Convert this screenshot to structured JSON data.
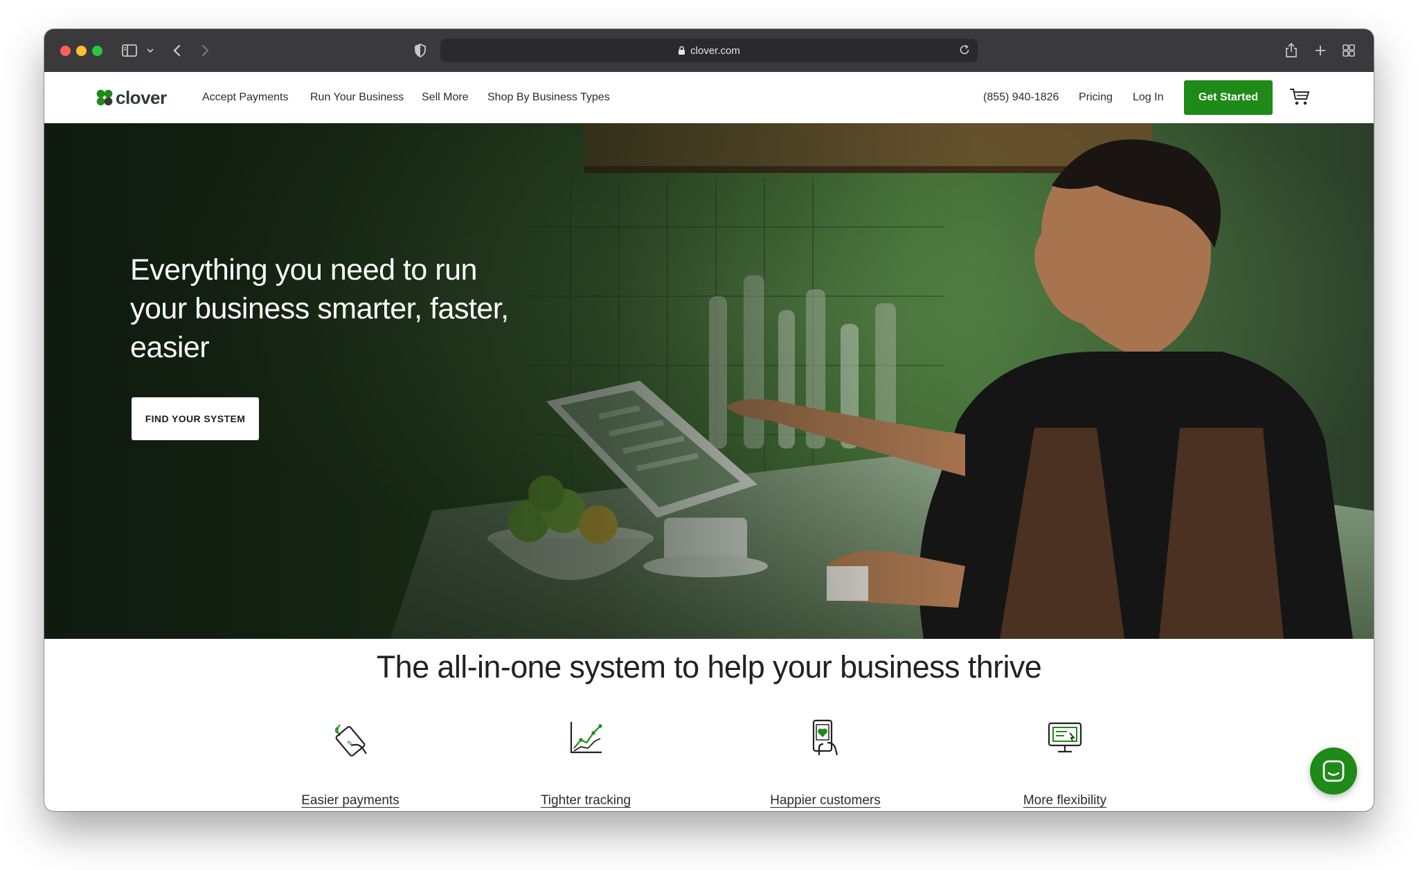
{
  "browser": {
    "url": "clover.com"
  },
  "nav": {
    "logo_text": "clover",
    "links": [
      "Accept Payments",
      "Run Your Business",
      "Sell More",
      "Shop By Business Types"
    ],
    "phone": "(855) 940-1826",
    "pricing": "Pricing",
    "login": "Log In",
    "cta": "Get Started",
    "cart_icon": "cart-icon"
  },
  "hero": {
    "headline": "Everything you need to run your business smarter, faster, easier",
    "button": "FIND YOUR SYSTEM"
  },
  "features": {
    "title": "The all-in-one system to help your business thrive",
    "items": [
      {
        "label": "Easier payments",
        "icon": "contactless-card-icon"
      },
      {
        "label": "Tighter tracking",
        "icon": "line-chart-icon"
      },
      {
        "label": "Happier customers",
        "icon": "phone-heart-icon"
      },
      {
        "label": "More flexibility",
        "icon": "monitor-pos-icon"
      }
    ]
  },
  "colors": {
    "brand_green": "#1e8a18",
    "chrome_dark": "#3a3a3c",
    "text_dark": "#222222"
  },
  "chat": {
    "icon": "chat-icon"
  }
}
